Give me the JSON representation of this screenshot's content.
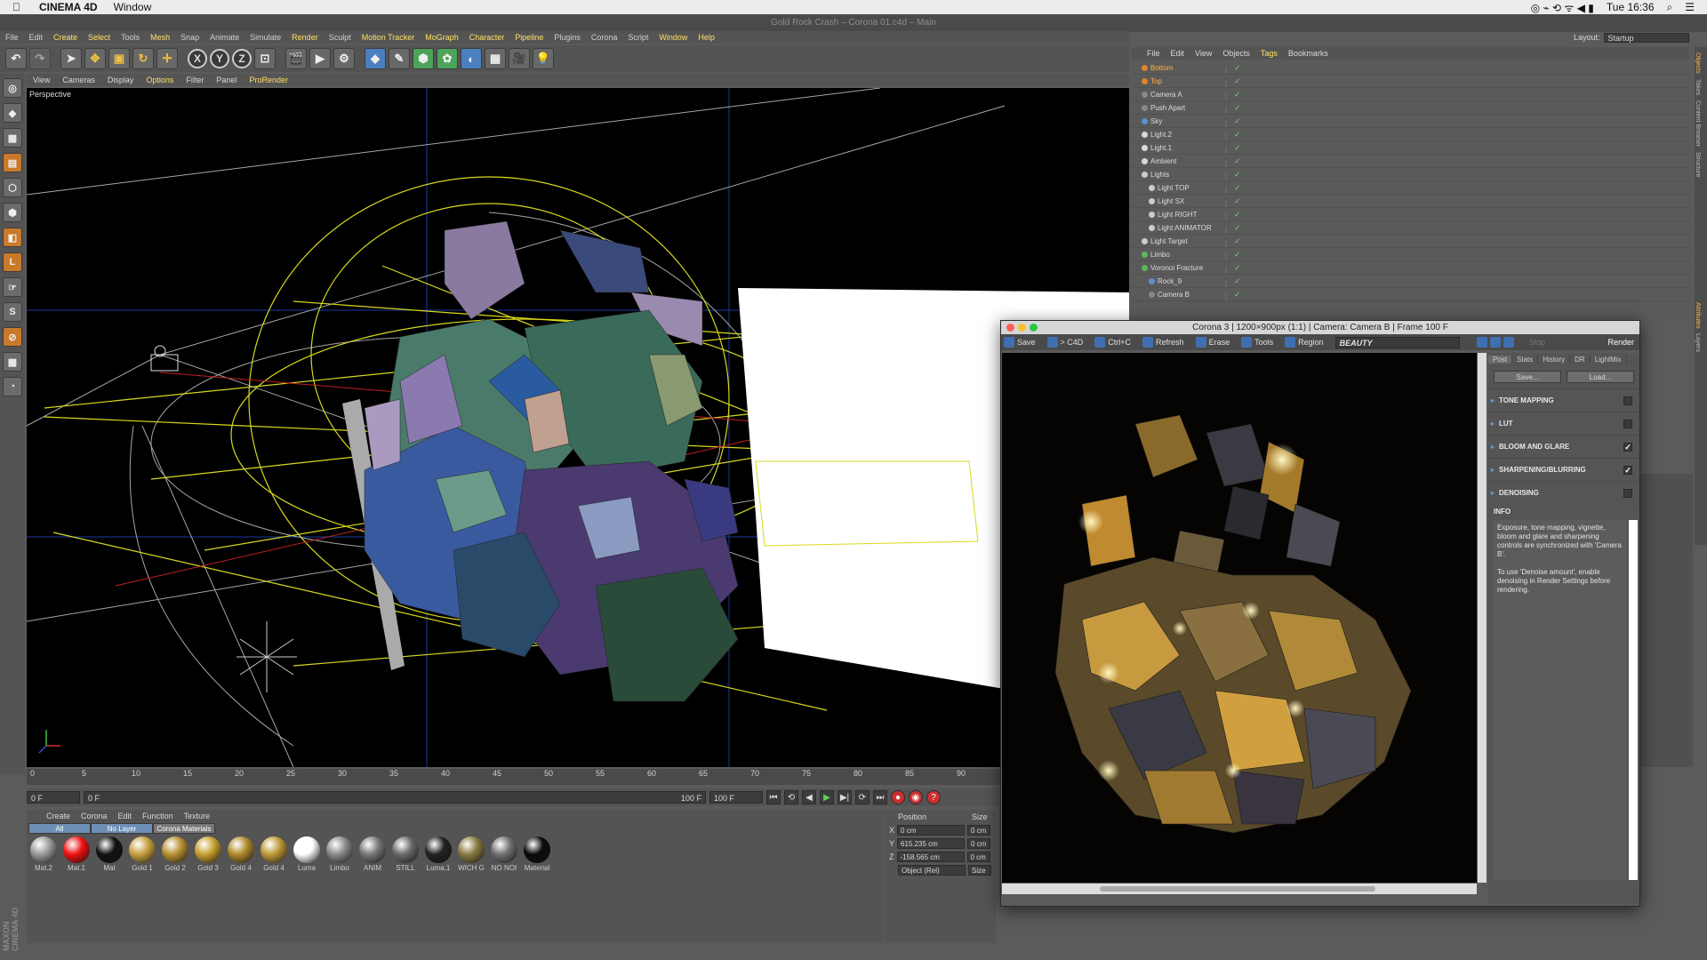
{
  "macos": {
    "app": "CINEMA 4D",
    "menu_window": "Window",
    "clock": "Tue 16:36"
  },
  "window_title": "Gold Rock Crash – Corona 01.c4d – Main",
  "main_menu": [
    "File",
    "Edit",
    "Create",
    "Select",
    "Tools",
    "Mesh",
    "Snap",
    "Animate",
    "Simulate",
    "Render",
    "Sculpt",
    "Motion Tracker",
    "MoGraph",
    "Character",
    "Pipeline",
    "Plugins",
    "Corona",
    "Script",
    "Window",
    "Help"
  ],
  "layout": {
    "label": "Layout:",
    "value": "Startup"
  },
  "toolbar_axes": [
    "X",
    "Y",
    "Z"
  ],
  "viewport": {
    "menu": [
      "View",
      "Cameras",
      "Display",
      "Options",
      "Filter",
      "Panel",
      "ProRender"
    ],
    "label": "Perspective"
  },
  "timeline": {
    "ticks": [
      "0",
      "5",
      "10",
      "15",
      "20",
      "25",
      "30",
      "35",
      "40",
      "45",
      "50",
      "55",
      "60",
      "65",
      "70",
      "75",
      "80",
      "85",
      "90"
    ],
    "start_field": "0 F",
    "current_field": "0 F",
    "end_field": "100 F",
    "end_field2": "100 F"
  },
  "materials": {
    "menu": [
      "Create",
      "Corona",
      "Edit",
      "Function",
      "Texture"
    ],
    "tabs": [
      "All",
      "No Layer",
      "Corona Materials"
    ],
    "items": [
      {
        "name": "Mat.2",
        "color": "#9a9a9a"
      },
      {
        "name": "Mat.1",
        "color": "#ee1111"
      },
      {
        "name": "Mat",
        "color": "#111111"
      },
      {
        "name": "Gold 1",
        "color": "#c8a040"
      },
      {
        "name": "Gold 2",
        "color": "#b89030"
      },
      {
        "name": "Gold 3",
        "color": "#c8a030"
      },
      {
        "name": "Gold 4",
        "color": "#b08a2a"
      },
      {
        "name": "Gold 4",
        "color": "#c09a38"
      },
      {
        "name": "Luma",
        "color": "#ffffff"
      },
      {
        "name": "Limbo",
        "color": "#8a8a8a"
      },
      {
        "name": "ANIM",
        "color": "#777777"
      },
      {
        "name": "STILL",
        "color": "#6a6a6a"
      },
      {
        "name": "Luma.1",
        "color": "#222222"
      },
      {
        "name": "WICH G",
        "color": "#8a7a40"
      },
      {
        "name": "NO NOI",
        "color": "#707070"
      },
      {
        "name": "Material",
        "color": "#0a0a0a"
      }
    ]
  },
  "coords": {
    "head_pos": "Position",
    "head_size": "Size",
    "rows": [
      {
        "axis": "X",
        "pos": "0 cm",
        "size": "0 cm"
      },
      {
        "axis": "Y",
        "pos": "615.235 cm",
        "size": "0 cm"
      },
      {
        "axis": "Z",
        "pos": "-158.565 cm",
        "size": "0 cm"
      }
    ],
    "mode": "Object (Rel)",
    "size_btn": "Size"
  },
  "object_manager": {
    "menu": [
      "File",
      "Edit",
      "View",
      "Objects",
      "Tags",
      "Bookmarks"
    ],
    "objects": [
      {
        "name": "Bottom",
        "indent": 0,
        "selected": true,
        "dot": "#e0842a"
      },
      {
        "name": "Top",
        "indent": 0,
        "selected": true,
        "dot": "#e0842a"
      },
      {
        "name": "Camera A",
        "indent": 0,
        "selected": false,
        "dot": "#888888"
      },
      {
        "name": "Push Apart",
        "indent": 0,
        "selected": false,
        "dot": "#888888"
      },
      {
        "name": "Sky",
        "indent": 0,
        "selected": false,
        "dot": "#5a8fd0"
      },
      {
        "name": "Light.2",
        "indent": 0,
        "selected": false,
        "dot": "#d8d8d8"
      },
      {
        "name": "Light.1",
        "indent": 0,
        "selected": false,
        "dot": "#d8d8d8"
      },
      {
        "name": "Ambient",
        "indent": 0,
        "selected": false,
        "dot": "#d8d8d8"
      },
      {
        "name": "Lights",
        "indent": 0,
        "selected": false,
        "dot": "#cccccc"
      },
      {
        "name": "Light TOP",
        "indent": 1,
        "selected": false,
        "dot": "#cccccc"
      },
      {
        "name": "Light SX",
        "indent": 1,
        "selected": false,
        "dot": "#cccccc"
      },
      {
        "name": "Light RIGHT",
        "indent": 1,
        "selected": false,
        "dot": "#cccccc"
      },
      {
        "name": "Light ANIMATOR",
        "indent": 1,
        "selected": false,
        "dot": "#cccccc"
      },
      {
        "name": "Light Target",
        "indent": 0,
        "selected": false,
        "dot": "#cccccc"
      },
      {
        "name": "Limbo",
        "indent": 0,
        "selected": false,
        "dot": "#5ab85a"
      },
      {
        "name": "Voronoi Fracture",
        "indent": 0,
        "selected": false,
        "dot": "#5ab85a"
      },
      {
        "name": "Rock_9",
        "indent": 1,
        "selected": false,
        "dot": "#5a8fd0"
      },
      {
        "name": "Camera B",
        "indent": 1,
        "selected": false,
        "dot": "#888888"
      }
    ]
  },
  "side_tabs": [
    "Objects",
    "Takes",
    "Content Browser",
    "Structure"
  ],
  "side_tabs_lower": [
    "Attributes",
    "Layers"
  ],
  "corona": {
    "title": "Corona 3 | 1200×900px (1:1) | Camera: Camera B | Frame 100 F",
    "toolbar": [
      "Save",
      "> C4D",
      "Ctrl+C",
      "Refresh",
      "Erase",
      "Tools",
      "Region"
    ],
    "pass": "BEAUTY",
    "stop": "Stop",
    "render": "Render",
    "tabs": [
      "Post",
      "Stats",
      "History",
      "DR",
      "LightMix"
    ],
    "save_btn": "Save...",
    "load_btn": "Load...",
    "sections": [
      {
        "label": "TONE MAPPING",
        "checked": false
      },
      {
        "label": "LUT",
        "checked": false
      },
      {
        "label": "BLOOM AND GLARE",
        "checked": true
      },
      {
        "label": "SHARPENING/BLURRING",
        "checked": true
      },
      {
        "label": "DENOISING",
        "checked": false
      }
    ],
    "info_head": "INFO",
    "info_p1": "Exposure, tone mapping, vignette, bloom and glare and sharpening controls are synchronized with 'Camera B'.",
    "info_p2": "To use 'Denoise amount', enable denoising in Render Settings before rendering."
  },
  "branding": "MAXON CINEMA 4D"
}
